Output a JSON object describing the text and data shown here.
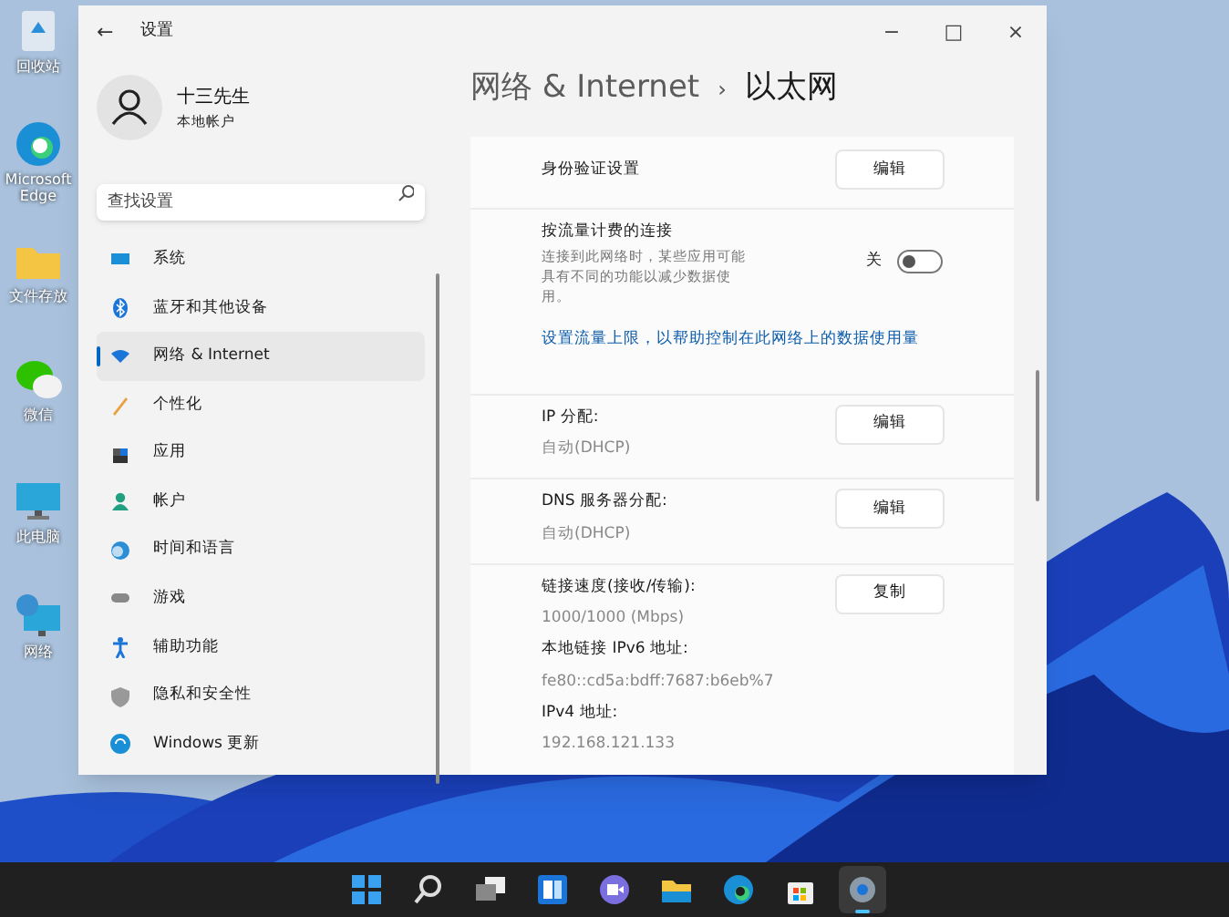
{
  "desktop_icons": [
    {
      "kind": "recycle",
      "label": "回收站"
    },
    {
      "kind": "edge",
      "label": "Microsoft Edge"
    },
    {
      "kind": "folder",
      "label": "文件存放"
    },
    {
      "kind": "wechat",
      "label": "微信"
    },
    {
      "kind": "pc",
      "label": "此电脑"
    },
    {
      "kind": "network",
      "label": "网络"
    }
  ],
  "window": {
    "title": "设置",
    "back": "←",
    "controls": [
      "−",
      "□",
      "×"
    ],
    "user": {
      "name": "十三先生",
      "account": "本地帐户"
    },
    "search": {
      "placeholder": "查找设置"
    },
    "nav": [
      {
        "kind": "system",
        "label": "系统",
        "selected": false
      },
      {
        "kind": "bluetooth",
        "label": "蓝牙和其他设备",
        "selected": false
      },
      {
        "kind": "network",
        "label": "网络 & Internet",
        "selected": true
      },
      {
        "kind": "personalize",
        "label": "个性化",
        "selected": false
      },
      {
        "kind": "apps",
        "label": "应用",
        "selected": false
      },
      {
        "kind": "account",
        "label": "帐户",
        "selected": false
      },
      {
        "kind": "time",
        "label": "时间和语言",
        "selected": false
      },
      {
        "kind": "gaming",
        "label": "游戏",
        "selected": false
      },
      {
        "kind": "accessibility",
        "label": "辅助功能",
        "selected": false
      },
      {
        "kind": "privacy",
        "label": "隐私和安全性",
        "selected": false
      },
      {
        "kind": "update",
        "label": "Windows 更新",
        "selected": false
      }
    ],
    "breadcrumb": {
      "parent": "网络 & Internet",
      "separator": "›",
      "current": "以太网"
    },
    "sections": [
      {
        "items": [
          {
            "kind": "button_row",
            "label": "身份验证设置",
            "button": "编辑"
          }
        ]
      },
      {
        "items": [
          {
            "kind": "toggle_row",
            "label": "按流量计费的连接",
            "description": "连接到此网络时，某些应用可能具有不同的功能以减少数据使用。",
            "state_label": "关",
            "on": false
          },
          {
            "kind": "link",
            "text": "设置流量上限，以帮助控制在此网络上的数据使用量"
          }
        ]
      },
      {
        "items": [
          {
            "kind": "value_row",
            "label": "IP 分配:",
            "value": "自动(DHCP)",
            "button": "编辑"
          }
        ]
      },
      {
        "items": [
          {
            "kind": "value_row",
            "label": "DNS 服务器分配:",
            "value": "自动(DHCP)",
            "button": "编辑"
          }
        ]
      },
      {
        "items": [
          {
            "kind": "value_row",
            "label": "链接速度(接收/传输):",
            "value": "1000/1000 (Mbps)",
            "button": "复制"
          },
          {
            "kind": "info",
            "label": "本地链接 IPv6 地址:",
            "value": "fe80::cd5a:bdff:7687:b6eb%7"
          },
          {
            "kind": "info",
            "label": "IPv4 地址:",
            "value": "192.168.121.133"
          }
        ]
      }
    ]
  },
  "taskbar": [
    {
      "kind": "start",
      "selected": false
    },
    {
      "kind": "search",
      "selected": false
    },
    {
      "kind": "taskview",
      "selected": false
    },
    {
      "kind": "widgets",
      "selected": false
    },
    {
      "kind": "chat",
      "selected": false
    },
    {
      "kind": "explorer",
      "selected": false
    },
    {
      "kind": "edge",
      "selected": false
    },
    {
      "kind": "store",
      "selected": false
    },
    {
      "kind": "settings",
      "selected": true
    }
  ]
}
